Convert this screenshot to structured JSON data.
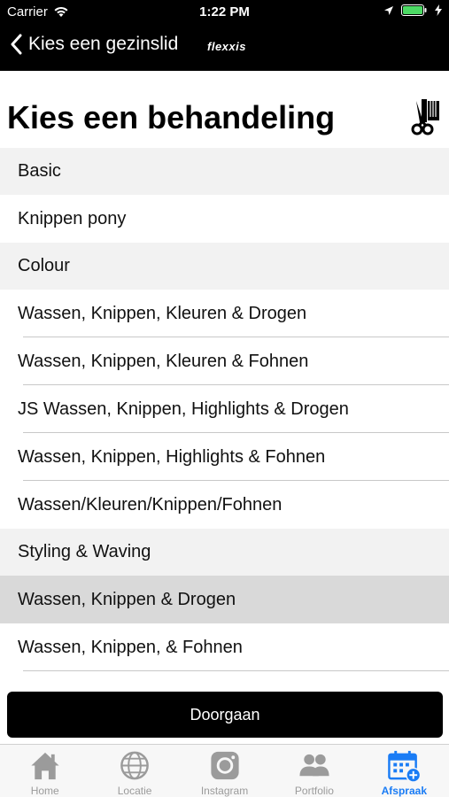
{
  "status_bar": {
    "carrier": "Carrier",
    "time": "1:22 PM"
  },
  "nav": {
    "back_label": "Kies een gezinslid",
    "logo": "flexxis"
  },
  "page_title": "Kies een behandeling",
  "sections": [
    {
      "title": "Basic",
      "items": [
        "Knippen pony"
      ]
    },
    {
      "title": "Colour",
      "items": [
        "Wassen, Knippen, Kleuren & Drogen",
        "Wassen, Knippen, Kleuren & Fohnen",
        "JS Wassen, Knippen, Highlights & Drogen",
        "Wassen, Knippen, Highlights & Fohnen",
        "Wassen/Kleuren/Knippen/Fohnen"
      ]
    },
    {
      "title": "Styling & Waving",
      "items": [
        "Wassen, Knippen & Drogen",
        "Wassen, Knippen, & Fohnen"
      ]
    }
  ],
  "selected_item": "Wassen, Knippen & Drogen",
  "cta_label": "Doorgaan",
  "tabs": [
    {
      "label": "Home",
      "icon": "home-icon"
    },
    {
      "label": "Locatie",
      "icon": "globe-icon"
    },
    {
      "label": "Instagram",
      "icon": "instagram-icon"
    },
    {
      "label": "Portfolio",
      "icon": "people-icon"
    },
    {
      "label": "Afspraak",
      "icon": "calendar-add-icon"
    }
  ],
  "active_tab": "Afspraak",
  "colors": {
    "bar": "#000000",
    "section_bg": "#f2f2f2",
    "selected_bg": "#d9d9d9",
    "accent": "#1a7cf5",
    "battery": "#4cd964"
  }
}
